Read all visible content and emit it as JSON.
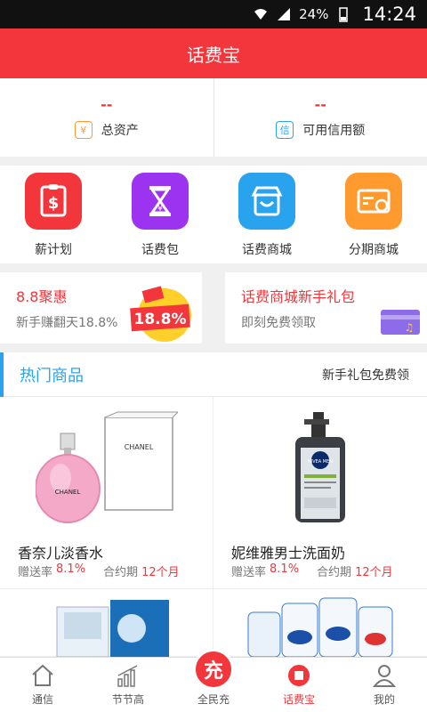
{
  "status_bar": {
    "battery": "24%",
    "time": "14:24"
  },
  "app_title": "话费宝",
  "assets": [
    {
      "value": "--",
      "label": "总资产",
      "icon": "¥"
    },
    {
      "value": "--",
      "label": "可用信用额",
      "icon": "信"
    }
  ],
  "quick_menu": [
    {
      "label": "薪计划",
      "icon": "money-card-icon",
      "color": "#f2363b"
    },
    {
      "label": "话费包",
      "icon": "hourglass-icon",
      "color": "#9b33f0"
    },
    {
      "label": "话费商城",
      "icon": "store-icon",
      "color": "#2aa3ef"
    },
    {
      "label": "分期商城",
      "icon": "credit-card-icon",
      "color": "#ff9a2e"
    }
  ],
  "promos": [
    {
      "title": "8.8聚惠",
      "subtitle": "新手赚翻天18.8%",
      "art_text": "18.8%"
    },
    {
      "title": "话费商城新手礼包",
      "subtitle": "即刻免费领取"
    }
  ],
  "hot_section": {
    "title": "热门商品",
    "link": "新手礼包免费领"
  },
  "products": [
    {
      "name": "香奈儿淡香水",
      "rate_label": "赠送率",
      "rate": "8.1%",
      "term_label": "合约期",
      "term": "12个月",
      "brand_text": "CHANEL"
    },
    {
      "name": "妮维雅男士洗面奶",
      "rate_label": "赠送率",
      "rate": "8.1%",
      "term_label": "合约期",
      "term": "12个月",
      "brand_text": "NIVEA MEN"
    },
    {
      "name": "",
      "rate_label": "",
      "rate": "",
      "term_label": "",
      "term": ""
    },
    {
      "name": "",
      "rate_label": "",
      "rate": "",
      "term_label": "",
      "term": ""
    }
  ],
  "tabs": [
    {
      "label": "通信",
      "icon": "home-icon"
    },
    {
      "label": "节节高",
      "icon": "bar-chart-icon"
    },
    {
      "label": "全民充",
      "icon_text": "充"
    },
    {
      "label": "话费宝",
      "icon": "record-icon"
    },
    {
      "label": "我的",
      "icon": "user-icon"
    }
  ],
  "colors": {
    "brand_red": "#f2363b",
    "accent_blue": "#2aa3ef",
    "orange": "#ff9a2e",
    "purple": "#9b33f0"
  }
}
